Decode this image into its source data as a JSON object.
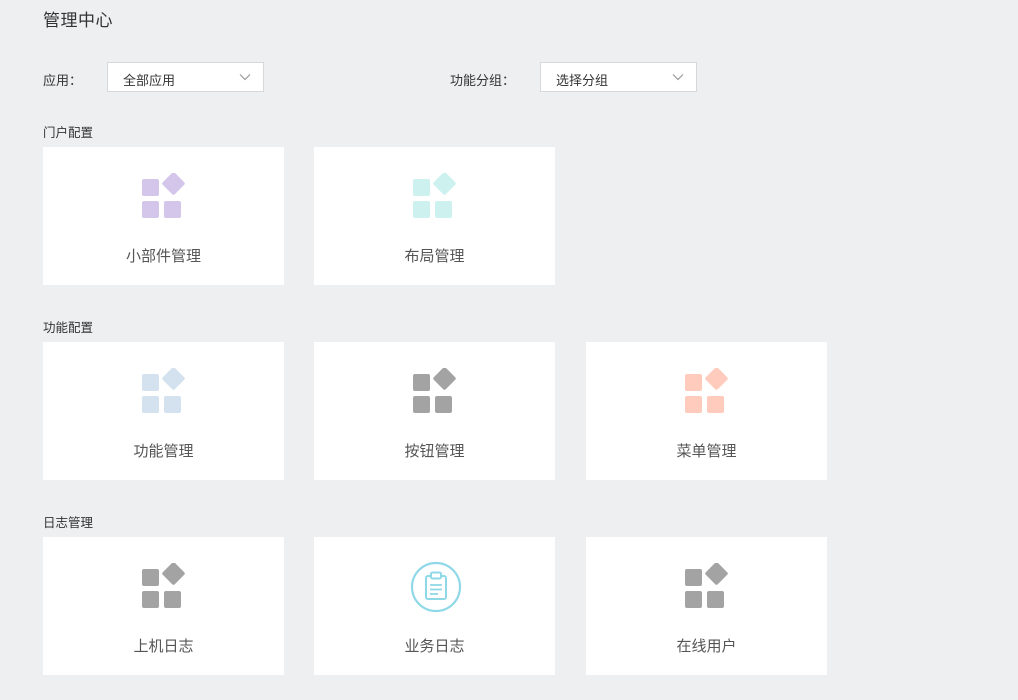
{
  "page": {
    "title": "管理中心"
  },
  "filters": {
    "app_label": "应用：",
    "app_value": "全部应用",
    "group_label": "功能分组：",
    "group_value": "选择分组"
  },
  "sections": [
    {
      "title": "门户配置",
      "cards": [
        {
          "label": "小部件管理",
          "icon": "grid-diamond-icon",
          "color": "#d3c6ea"
        },
        {
          "label": "布局管理",
          "icon": "grid-diamond-icon",
          "color": "#cdf1ef"
        }
      ]
    },
    {
      "title": "功能配置",
      "cards": [
        {
          "label": "功能管理",
          "icon": "grid-diamond-icon",
          "color": "#d4e2f0"
        },
        {
          "label": "按钮管理",
          "icon": "grid-diamond-icon",
          "color": "#a3a3a3"
        },
        {
          "label": "菜单管理",
          "icon": "grid-diamond-icon",
          "color": "#ffcbbd"
        }
      ]
    },
    {
      "title": "日志管理",
      "cards": [
        {
          "label": "上机日志",
          "icon": "grid-diamond-icon",
          "color": "#a3a3a3"
        },
        {
          "label": "业务日志",
          "icon": "clipboard-icon",
          "color": "#8fd8e8"
        },
        {
          "label": "在线用户",
          "icon": "grid-diamond-icon",
          "color": "#a3a3a3"
        }
      ]
    }
  ]
}
